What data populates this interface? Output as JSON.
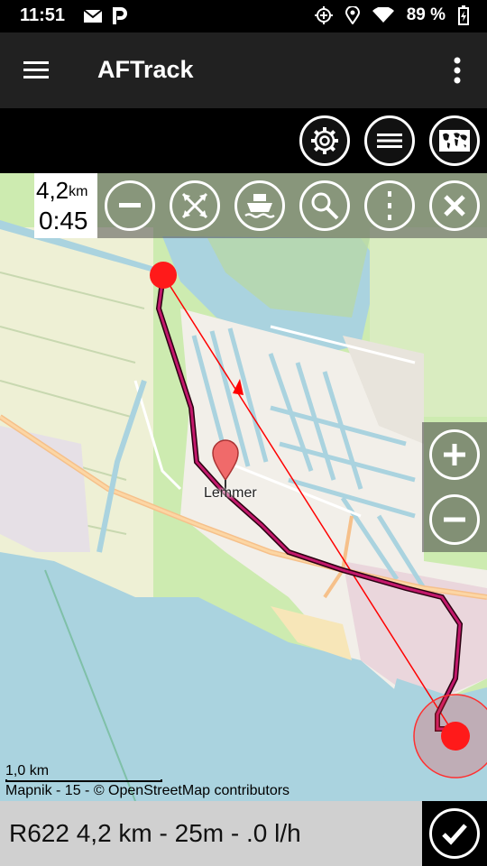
{
  "status_bar": {
    "time": "11:51",
    "battery": "89 %",
    "icons": [
      "mail-icon",
      "parking-icon",
      "gps-plus-icon",
      "location-icon",
      "wifi-icon",
      "battery-charging-icon"
    ]
  },
  "app_bar": {
    "title": "AFTrack",
    "menu_icon": "hamburger-icon",
    "overflow_icon": "overflow-icon"
  },
  "top_actions": [
    "settings-icon",
    "list-icon",
    "world-map-icon"
  ],
  "track_info": {
    "distance": "4,2",
    "distance_unit": "km",
    "duration": "0:45"
  },
  "track_actions": [
    "remove-icon",
    "cross-arrows-icon",
    "boat-icon",
    "search-icon",
    "more-vertical-icon",
    "close-icon"
  ],
  "map": {
    "town_label": "Lemmer",
    "scale_label": "1,0 km",
    "attribution": "Mapnik - 15 - © OpenStreetMap contributors",
    "zoom_in": "zoom-in-icon",
    "zoom_out": "zoom-out-icon",
    "colors": {
      "water": "#aad3df",
      "land": "#f2efe9",
      "green": "#cdebb0",
      "track": "#8b0a50",
      "marker": "#ff1a1a"
    }
  },
  "bottom_bar": {
    "summary": "R622 4,2 km - 25m - .0 l/h",
    "confirm_icon": "check-icon"
  }
}
